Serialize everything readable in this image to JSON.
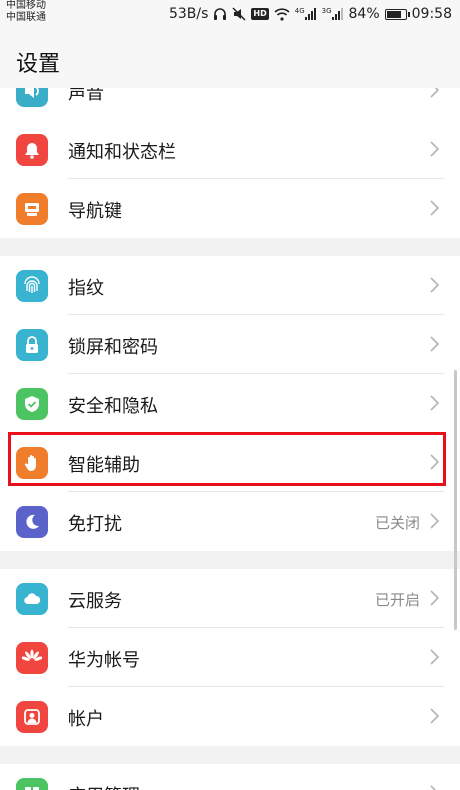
{
  "status_bar": {
    "carrier1": "中国移动",
    "carrier2": "中国联通",
    "speed": "53B/s",
    "hd": "HD",
    "net1": "4G",
    "net2": "3G",
    "battery": "84%",
    "battery_level": 0.84,
    "time": "09:58"
  },
  "header": {
    "title": "设置"
  },
  "rows": {
    "sound": {
      "label": "声音",
      "icon": "speaker-icon",
      "color": "#3aaec8"
    },
    "notifications": {
      "label": "通知和状态栏",
      "icon": "bell-icon",
      "color": "#f0463f"
    },
    "navigation": {
      "label": "导航键",
      "icon": "nav-key-icon",
      "color": "#f07d2b"
    },
    "fingerprint": {
      "label": "指纹",
      "icon": "fingerprint-icon",
      "color": "#38b3d0"
    },
    "lockscreen": {
      "label": "锁屏和密码",
      "icon": "lock-icon",
      "color": "#38b3d0"
    },
    "security": {
      "label": "安全和隐私",
      "icon": "shield-icon",
      "color": "#4cc462"
    },
    "smart_assist": {
      "label": "智能辅助",
      "icon": "hand-icon",
      "color": "#f07d2b"
    },
    "dnd": {
      "label": "免打扰",
      "status": "已关闭",
      "icon": "moon-icon",
      "color": "#5b62c9"
    },
    "cloud": {
      "label": "云服务",
      "status": "已开启",
      "icon": "cloud-icon",
      "color": "#38b3d0"
    },
    "huawei_id": {
      "label": "华为帐号",
      "icon": "huawei-icon",
      "color": "#f0463f"
    },
    "accounts": {
      "label": "帐户",
      "icon": "user-icon",
      "color": "#f0463f"
    },
    "apps": {
      "label": "应用管理",
      "icon": "grid-icon",
      "color": "#4cc462"
    }
  }
}
